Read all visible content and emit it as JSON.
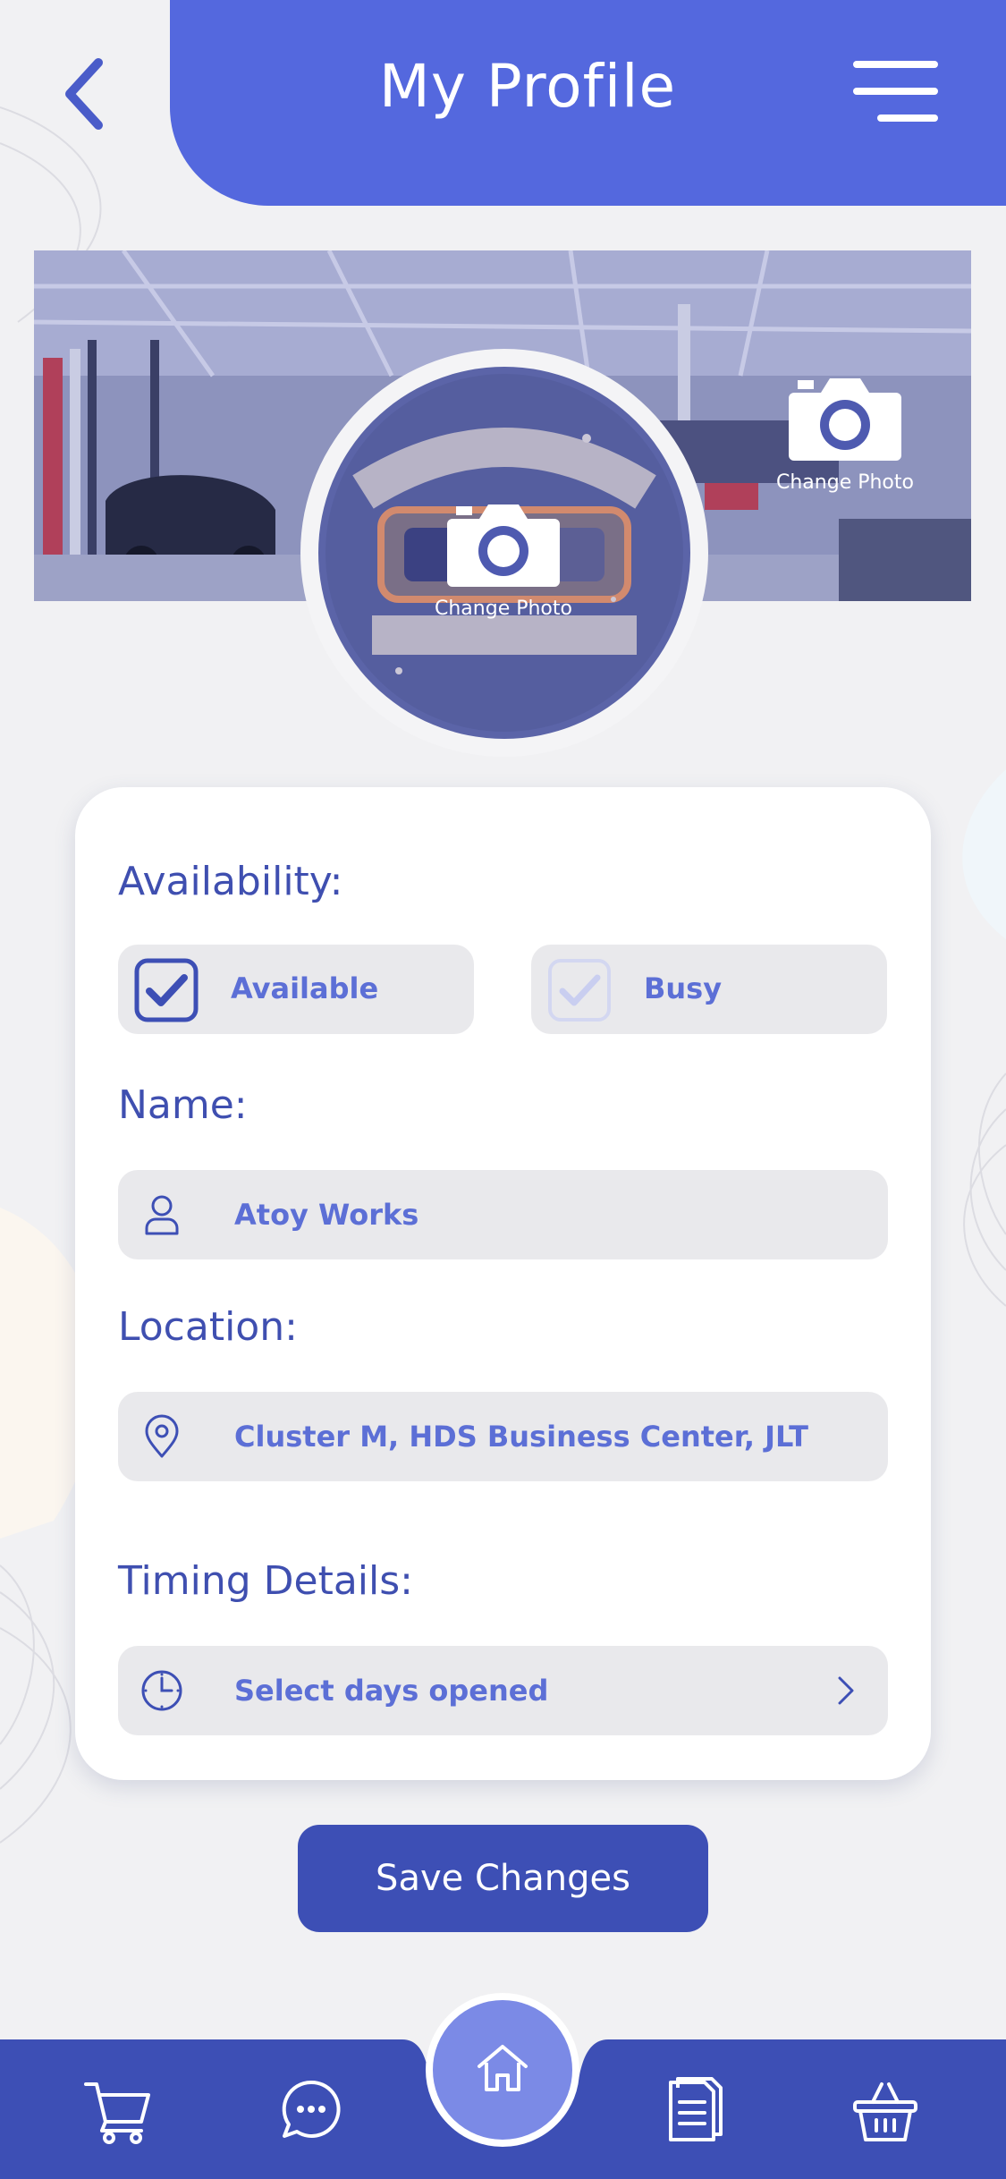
{
  "header": {
    "title": "My Profile"
  },
  "cover": {
    "change_photo_label": "Change Photo"
  },
  "avatar": {
    "change_photo_label": "Change Photo"
  },
  "form": {
    "availability": {
      "label": "Availability:",
      "options": [
        {
          "label": "Available",
          "checked": true
        },
        {
          "label": "Busy",
          "checked": false
        }
      ]
    },
    "name": {
      "label": "Name:",
      "value": "Atoy Works"
    },
    "location": {
      "label": "Location:",
      "value": "Cluster M, HDS Business Center, JLT"
    },
    "timing": {
      "label": "Timing Details:",
      "value": "Select days opened"
    }
  },
  "save_button": {
    "label": "Save Changes"
  },
  "tabbar": {
    "items": [
      {
        "name": "cart-icon"
      },
      {
        "name": "chat-icon"
      },
      {
        "name": "home-icon",
        "active": true
      },
      {
        "name": "documents-icon"
      },
      {
        "name": "basket-icon"
      }
    ]
  },
  "colors": {
    "primary": "#5468de",
    "dark_primary": "#3d4fb5",
    "field_bg": "#e9e9ec",
    "text": "#3f4fb0"
  }
}
